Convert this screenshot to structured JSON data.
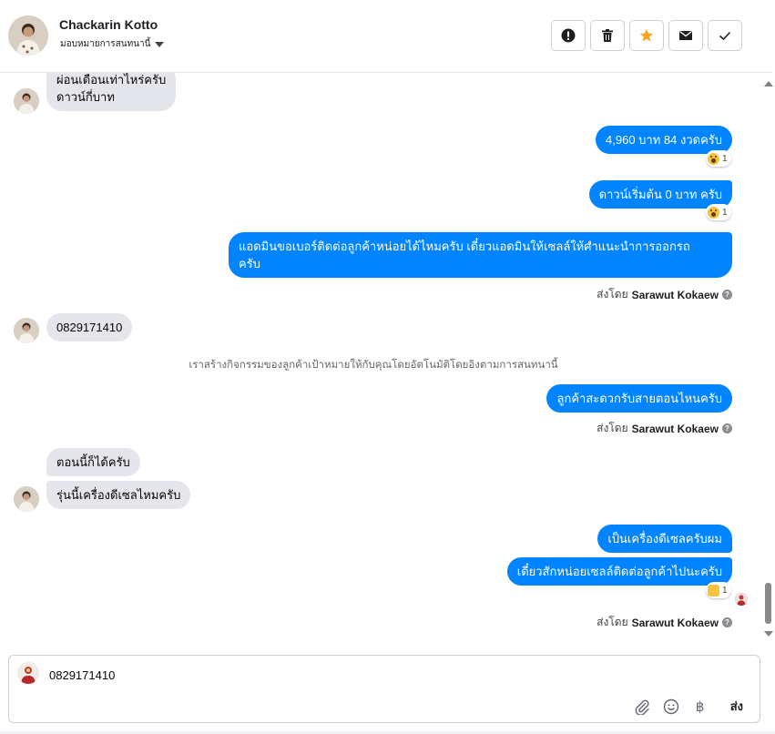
{
  "header": {
    "contact_name": "Chackarin Kotto",
    "assign_label": "มอบหมายการสนทนานี้",
    "actions": [
      {
        "name": "mark-spam-button",
        "icon": "alert-icon"
      },
      {
        "name": "delete-button",
        "icon": "trash-icon"
      },
      {
        "name": "star-button",
        "icon": "star-icon"
      },
      {
        "name": "mark-unread-button",
        "icon": "envelope-icon"
      },
      {
        "name": "mark-done-button",
        "icon": "check-icon"
      }
    ],
    "star_color": "#f5a623"
  },
  "messages": {
    "m1_line1": "ผ่อนเดือนเท่าไหร่ครับ",
    "m1_line2": "ดาวน์กี่บาท",
    "m2": "4,960 บาท 84 งวดครับ",
    "m2_reaction_count": "1",
    "m3": "ดาวน์เริ่มต้น 0 บาท ครับ",
    "m3_reaction_count": "1",
    "m4_line1": "แอดมินขอเบอร์ติดต่อลูกค้าหน่อยได้ไหมครับ เดี๋ยวแอดมินให้เซลล์ให้ศำแนะนำการออกรถ",
    "m4_line2": "ครับ",
    "m5": "0829171410",
    "system_note": "เราสร้างกิจกรรมของลูกค้าเป้าหมายให้กับคุณโดยอัตโนมัติโดยอิงตามการสนทนานี้",
    "m6": "ลูกค้าสะดวกรับสายตอนไหนครับ",
    "m7": "ตอนนี้ก็ได้ครับ",
    "m8": "รุ่นนี้เครื่องดีเซลไหมครับ",
    "m9": "เป็นเครื่องดีเซลครับผม",
    "m10": "เดี๋ยวสักหน่อยเซลล์ติดต่อลูกค้าไปนะครับ",
    "m10_reaction_count": "1"
  },
  "sent_by": {
    "prefix": "ส่งโดย",
    "agent": "Sarawut Kokaew",
    "help": "?"
  },
  "composer": {
    "value": "0829171410",
    "send_label": "ส่ง",
    "tools": [
      "paperclip-icon",
      "emoji-icon",
      "baht-icon"
    ],
    "baht_symbol": "฿"
  },
  "colors": {
    "outgoing_bubble": "#0084ff",
    "incoming_bubble": "#e4e6eb"
  }
}
